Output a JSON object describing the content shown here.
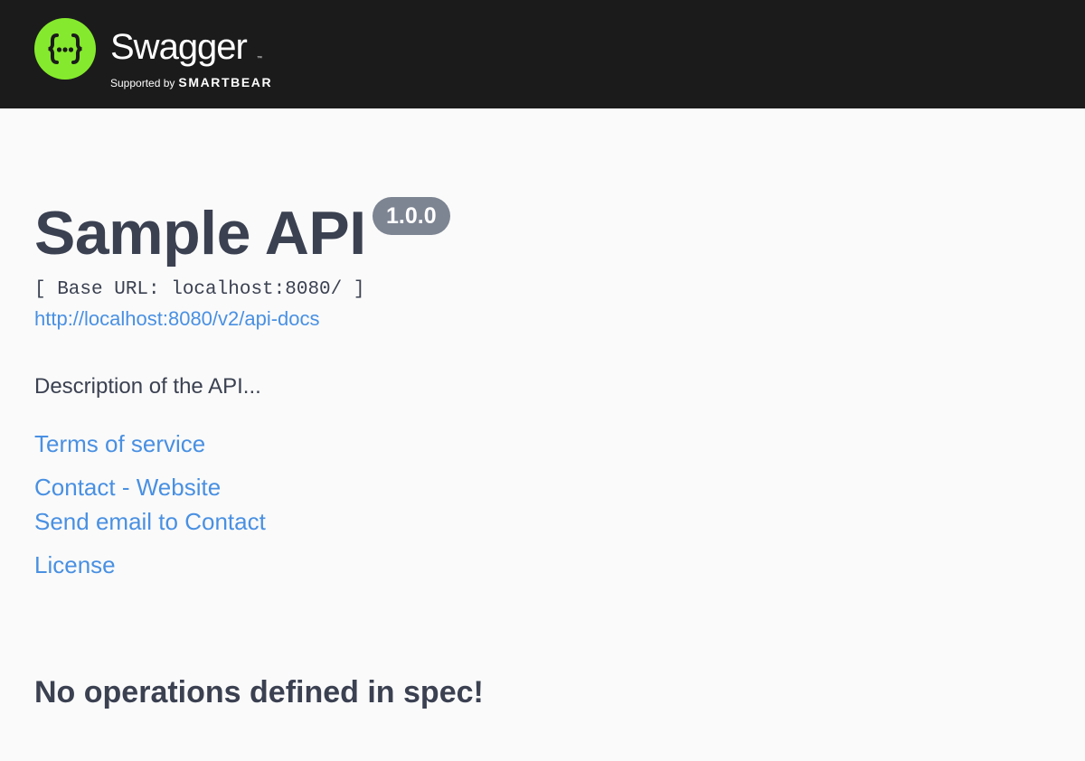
{
  "header": {
    "logo_word": "Swagger",
    "logo_tm": "™",
    "supported_by": "Supported by",
    "company": "SMARTBEAR",
    "logo_icon": "swagger-braces-icon",
    "brand_color": "#85ea2d",
    "bar_color": "#1b1b1b"
  },
  "info": {
    "title": "Sample API",
    "version": "1.0.0",
    "base_url": "[ Base URL: localhost:8080/ ]",
    "spec_url": "http://localhost:8080/v2/api-docs",
    "description": "Description of the API...",
    "terms_label": "Terms of service",
    "contact_website_label": "Contact - Website",
    "contact_email_label": "Send email to Contact",
    "license_label": "License",
    "link_color": "#4990e2"
  },
  "operations": {
    "empty_message": "No operations defined in spec!"
  }
}
